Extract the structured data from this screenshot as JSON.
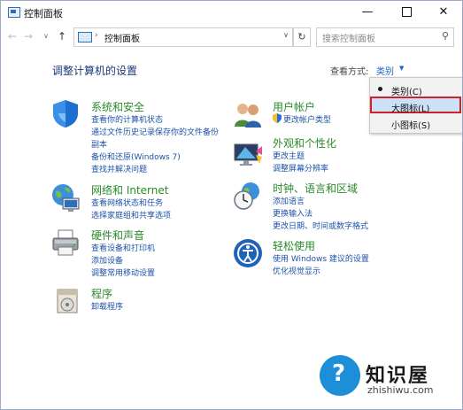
{
  "window": {
    "title": "控制面板",
    "minimize_glyph": "—",
    "close_glyph": "✕"
  },
  "address": {
    "back_glyph": "←",
    "forward_glyph": "→",
    "recent_glyph": "∨",
    "up_glyph": "↑",
    "separator": "›",
    "path": "控制面板",
    "dropdown_glyph": "∨",
    "refresh_glyph": "↻",
    "search_placeholder": "搜索控制面板",
    "search_glyph": "⚲"
  },
  "main": {
    "title": "调整计算机的设置",
    "view_by_label": "查看方式:",
    "view_by_value": "类别",
    "view_by_arrow": "▼"
  },
  "view_menu": {
    "items": [
      {
        "label": "类别(C)",
        "selected": true
      },
      {
        "label": "大图标(L)",
        "highlighted": true
      },
      {
        "label": "小图标(S)"
      }
    ]
  },
  "categories": [
    {
      "icon": "shield-icon",
      "title": "系统和安全",
      "links": [
        "查看你的计算机状态",
        "通过文件历史记录保存你的文件备份",
        "副本",
        "备份和还原(Windows 7)",
        "查找并解决问题"
      ]
    },
    {
      "icon": "network-globe-icon",
      "title": "网络和 Internet",
      "links": [
        "查看网络状态和任务",
        "选择家庭组和共享选项"
      ]
    },
    {
      "icon": "printer-icon",
      "title": "硬件和声音",
      "links": [
        "查看设备和打印机",
        "添加设备",
        "调整常用移动设置"
      ]
    },
    {
      "icon": "programs-disk-icon",
      "title": "程序",
      "links": [
        "卸载程序"
      ]
    },
    {
      "icon": "user-accounts-icon",
      "title": "用户帐户",
      "links": [
        "更改帐户类型"
      ]
    },
    {
      "icon": "appearance-monitor-icon",
      "title": "外观和个性化",
      "links": [
        "更改主题",
        "调整屏幕分辨率"
      ]
    },
    {
      "icon": "clock-globe-icon",
      "title": "时钟、语言和区域",
      "links": [
        "添加语言",
        "更换输入法",
        "更改日期、时间或数字格式"
      ]
    },
    {
      "icon": "ease-of-access-icon",
      "title": "轻松使用",
      "links": [
        "使用 Windows 建议的设置",
        "优化视觉显示"
      ]
    }
  ],
  "uac_shield_icon": "uac-shield-icon",
  "watermark": {
    "glyph": "?",
    "title": "知识屋",
    "url": "zhishiwu.com"
  },
  "colors": {
    "link": "#1d52a8",
    "category_title": "#2a8a2a",
    "highlight": "#cce0f7",
    "highlight_border": "#d0202a",
    "watermark": "#1c8fd8"
  }
}
